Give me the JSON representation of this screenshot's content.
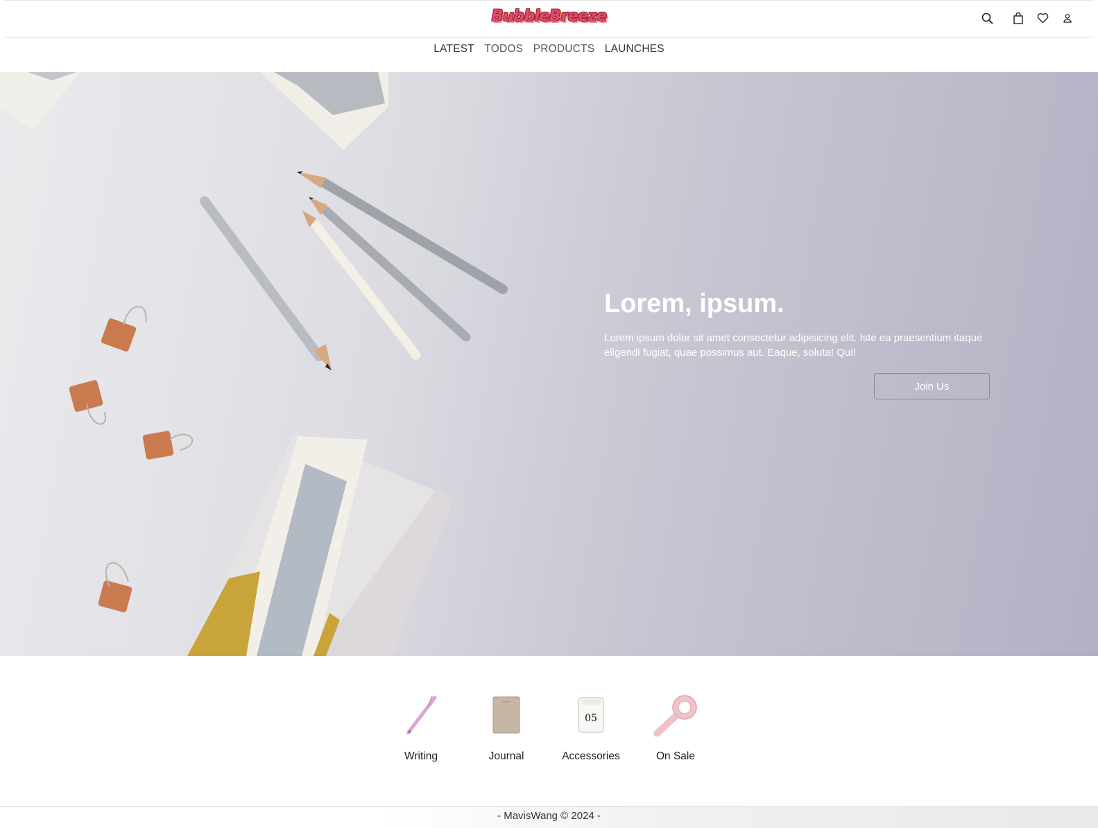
{
  "header": {
    "logo_text": "BubbleBreeze",
    "icons": [
      "search-icon",
      "shopping-bag-icon",
      "heart-icon",
      "user-icon"
    ]
  },
  "nav": {
    "items": [
      {
        "label": "LATEST"
      },
      {
        "label": "TODOS"
      },
      {
        "label": "PRODUCTS"
      },
      {
        "label": "LAUNCHES"
      }
    ]
  },
  "hero": {
    "title": "Lorem, ipsum.",
    "text": "Lorem ipsum dolor sit amet consectetur adipisicing elit. Iste ea praesentium itaque eligendi fugiat, quae possimus aut. Eaque, soluta! Qui!",
    "button_label": "Join Us"
  },
  "categories": [
    {
      "label": "Writing",
      "icon": "pen-icon"
    },
    {
      "label": "Journal",
      "icon": "notebook-icon"
    },
    {
      "label": "Accessories",
      "icon": "candle-icon",
      "badge": "05"
    },
    {
      "label": "On Sale",
      "icon": "washi-tape-icon"
    }
  ],
  "footer": {
    "text": "- MavisWang © 2024 -"
  },
  "colors": {
    "accent_pink": "#e6457a",
    "hero_tint": "#b3b0c4"
  }
}
